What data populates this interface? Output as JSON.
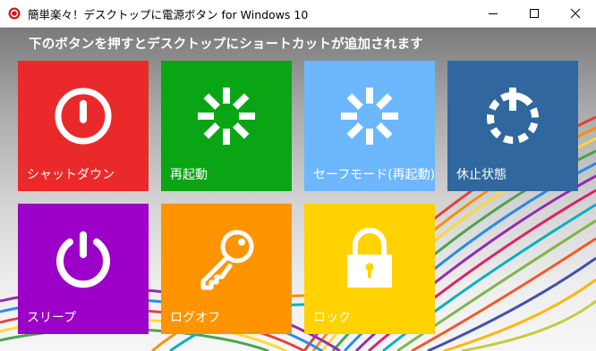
{
  "window": {
    "title": "簡単楽々！デスクトップに電源ボタン for Windows 10",
    "app_icon": "red-circle-icon",
    "controls": {
      "minimize_icon": "minimize-icon",
      "maximize_icon": "maximize-icon",
      "close_icon": "close-icon"
    }
  },
  "main": {
    "instruction": "下のボタンを押すとデスクトップにショートカットが追加されます"
  },
  "tiles": [
    {
      "label": "シャットダウン",
      "icon": "power-off-icon",
      "color": "#ea2a2a"
    },
    {
      "label": "再起動",
      "icon": "restart-spinner-icon",
      "color": "#0aa514"
    },
    {
      "label": "セーフモード(再起動)",
      "icon": "safemode-spinner-icon",
      "color": "#6cb7ff"
    },
    {
      "label": "休止状態",
      "icon": "hibernate-icon",
      "color": "#2f679e"
    },
    {
      "label": "スリープ",
      "icon": "sleep-power-icon",
      "color": "#9c00c8"
    },
    {
      "label": "ログオフ",
      "icon": "key-icon",
      "color": "#ff9400"
    },
    {
      "label": "ロック",
      "icon": "padlock-icon",
      "color": "#ffd200"
    }
  ]
}
